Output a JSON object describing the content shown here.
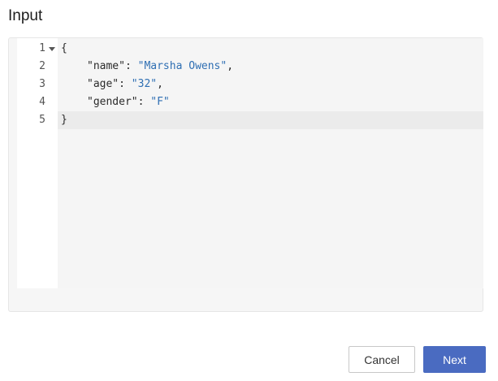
{
  "header": {
    "title": "Input"
  },
  "editor": {
    "lines": [
      {
        "number": "1",
        "open_brace": "{"
      },
      {
        "number": "2",
        "key": "\"name\"",
        "sep": ": ",
        "value": "\"Marsha Owens\"",
        "trail": ","
      },
      {
        "number": "3",
        "key": "\"age\"",
        "sep": ": ",
        "value": "\"32\"",
        "trail": ","
      },
      {
        "number": "4",
        "key": "\"gender\"",
        "sep": ": ",
        "value": "\"F\"",
        "trail": ""
      },
      {
        "number": "5",
        "close_brace": "}"
      }
    ],
    "fold_icon": "fold-arrow-down-icon",
    "colors": {
      "string": "#2f6fb3",
      "active_line": "#ebebeb"
    }
  },
  "footer": {
    "cancel_label": "Cancel",
    "next_label": "Next",
    "primary_color": "#4a6bc1"
  }
}
